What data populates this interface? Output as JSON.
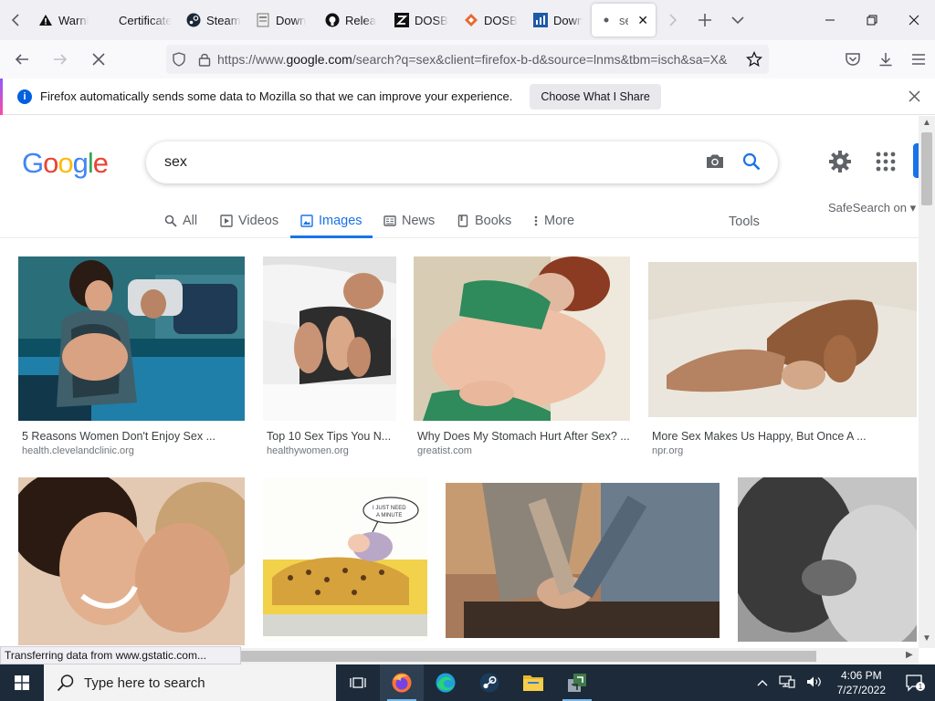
{
  "browser": {
    "tabs": [
      {
        "label": "Warni",
        "icon": "warning-icon"
      },
      {
        "label": "Certificate",
        "icon": ""
      },
      {
        "label": "Steam",
        "icon": "steam-icon"
      },
      {
        "label": "Down",
        "icon": "download-page-icon"
      },
      {
        "label": "Relea",
        "icon": "github-icon"
      },
      {
        "label": "DOSB",
        "icon": "z-icon"
      },
      {
        "label": "DOSB",
        "icon": "diamond-icon"
      },
      {
        "label": "Down",
        "icon": "chart-icon"
      },
      {
        "label": "sex",
        "icon": "loading-dot-icon",
        "active": true
      }
    ],
    "url_prefix": "https://www.",
    "url_domain": "google.com",
    "url_rest": "/search?q=sex&client=firefox-b-d&source=lnms&tbm=isch&sa=X&",
    "notification": {
      "message": "Firefox automatically sends some data to Mozilla so that we can improve your experience.",
      "button": "Choose What I Share"
    },
    "status_text": "Transferring data from www.gstatic.com..."
  },
  "google": {
    "logo_letters": [
      "G",
      "o",
      "o",
      "g",
      "l",
      "e"
    ],
    "query": "sex",
    "tabs": {
      "all": "All",
      "videos": "Videos",
      "images": "Images",
      "news": "News",
      "books": "Books",
      "more": "More"
    },
    "tools": "Tools",
    "safesearch": "SafeSearch on",
    "results": [
      {
        "title": "5 Reasons Women Don't Enjoy Sex ...",
        "source": "health.clevelandclinic.org"
      },
      {
        "title": "Top 10 Sex Tips You N...",
        "source": "healthywomen.org"
      },
      {
        "title": "Why Does My Stomach Hurt After Sex? ...",
        "source": "greatist.com"
      },
      {
        "title": "More Sex Makes Us Happy, But Once A ...",
        "source": "npr.org"
      }
    ],
    "cartoon_bubble": "I JUST NEED A MINUTE"
  },
  "taskbar": {
    "search_placeholder": "Type here to search",
    "time": "4:06 PM",
    "date": "7/27/2022",
    "notification_count": "1"
  },
  "colors": {
    "google_blue": "#1a73e8",
    "taskbar": "#1c2a3a"
  }
}
